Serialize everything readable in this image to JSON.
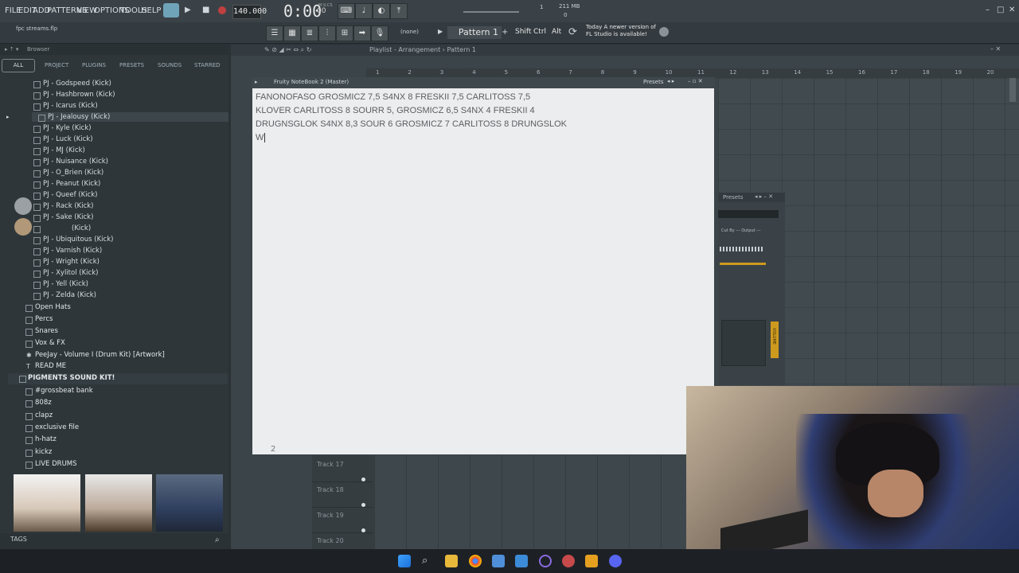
{
  "menu": [
    "FILE",
    "EDIT",
    "ADD",
    "PATTERNS",
    "VIEW",
    "OPTIONS",
    "TOOLS",
    "HELP"
  ],
  "transport": {
    "tempo": "140.000",
    "time_main": "0:00",
    "time_sub": "00",
    "time_label": "M:S:CS",
    "cpu_value": "1",
    "memory": "211 MB",
    "memory_sub": "0"
  },
  "hint_bar": {
    "file": "fpc streams.flp"
  },
  "toolbar": {
    "pattern_name": "Pattern 1",
    "snap": "(none)",
    "keys": [
      "Shift",
      "Ctrl",
      "Alt"
    ],
    "news_day": "Today",
    "news_text": "A newer version of FL Studio is available!"
  },
  "browser": {
    "title": "Browser",
    "filters": [
      "ALL",
      "PROJECT",
      "PLUGINS",
      "PRESETS",
      "SOUNDS",
      "STARRED"
    ],
    "kicks": [
      "PJ - Godspeed (Kick)",
      "PJ - Hashbrown (Kick)",
      "PJ - Icarus (Kick)",
      "PJ - Jealousy (Kick)",
      "PJ - Kyle (Kick)",
      "PJ - Luck (Kick)",
      "PJ - MJ (Kick)",
      "PJ - Nuisance (Kick)",
      "PJ - O_Brien (Kick)",
      "PJ - Peanut (Kick)",
      "PJ - Queef (Kick)",
      "PJ - Rack (Kick)",
      "PJ - Sake (Kick)",
      "(Kick)",
      "PJ - Ubiquitous (Kick)",
      "PJ - Varnish (Kick)",
      "PJ - Wright (Kick)",
      "PJ - Xylitol (Kick)",
      "PJ - Yell (Kick)",
      "PJ - Zelda (Kick)"
    ],
    "folders": [
      "Open Hats",
      "Percs",
      "Snares",
      "Vox & FX"
    ],
    "artwork": "PeeJay - Volume I (Drum Kit) [Artwork]",
    "readme": "READ ME",
    "kit_title": "PIGMENTS SOUND KIT!",
    "kit_folders": [
      "#grossbeat bank",
      "808z",
      "clapz",
      "exclusive file",
      "h-hatz",
      "kickz",
      "LIVE DRUMS"
    ],
    "tags_label": "TAGS"
  },
  "playlist": {
    "title": "Playlist - Arrangement",
    "pattern": "Pattern 1",
    "ruler": [
      "1",
      "2",
      "3",
      "4",
      "5",
      "6",
      "7",
      "8",
      "9",
      "10",
      "11",
      "12",
      "13",
      "14",
      "15",
      "16",
      "17",
      "18",
      "19",
      "20"
    ],
    "tracks": [
      "Track 17",
      "Track 18",
      "Track 19",
      "Track 20"
    ]
  },
  "notebook": {
    "title": "Fruity NoteBook 2 (Master)",
    "presets": "Presets",
    "lines": [
      "FANONOFASO GROSMICZ 7,5 S4NX 8 FRESKII 7,5 CARLITOSS 7,5",
      "KLOVER CARLITOSS 8 SOURR 5, GROSMICZ 6,5 S4NX 4 FRESKII 4",
      "DRUGNSGLOK S4NX 8,3 SOUR 6 GROSMICZ 7 CARLITOSS 8 DRUNGSLOK",
      "W"
    ],
    "page": "2"
  },
  "channel_rack": {
    "presets": "Presets",
    "cut_by": "Cut By ---",
    "output": "Output ---",
    "volume_label": "VOLUME"
  },
  "colors": {
    "accent": "#ce9a1e",
    "notebook_bg": "#ecedef",
    "ui_bg": "#2b3236"
  }
}
